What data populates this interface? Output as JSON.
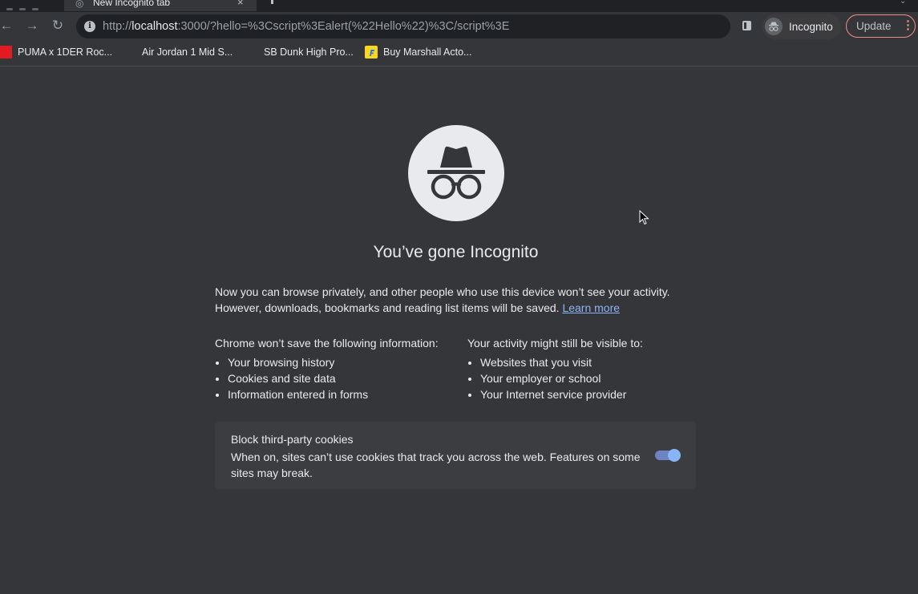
{
  "tabs": {
    "active_title": "New Incognito tab",
    "close_glyph": "×"
  },
  "toolbar": {
    "back_glyph": "←",
    "forward_glyph": "→",
    "reload_glyph": "↻",
    "url_scheme": "http://",
    "url_host": "localhost",
    "url_rest": ":3000/?hello=%3Cscript%3Ealert(%22Hello%22)%3C/script%3E",
    "incognito_label": "Incognito",
    "update_label": "Update",
    "menu_glyph": "⋮"
  },
  "bookmarks": [
    {
      "label": "PUMA x 1DER Roc...",
      "icon": "puma-favicon",
      "color": "#e21b23"
    },
    {
      "label": "Air Jordan 1 Mid S...",
      "icon": "blank-favicon",
      "color": ""
    },
    {
      "label": "SB Dunk High Pro...",
      "icon": "blank-favicon",
      "color": ""
    },
    {
      "label": "Buy Marshall Acto...",
      "icon": "flipkart-favicon",
      "color": "#f9d71c"
    }
  ],
  "page": {
    "heading": "You’ve gone Incognito",
    "intro_line1": "Now you can browse privately, and other people who use this device won’t see your activity.",
    "intro_line2": "However, downloads, bookmarks and reading list items will be saved.",
    "learn_more": "Learn more",
    "left_col_title_a": "Chrome ",
    "left_col_title_b": "won’t save",
    "left_col_title_c": " the following information:",
    "left_items": [
      "Your browsing history",
      "Cookies and site data",
      "Information entered in forms"
    ],
    "right_col_title_a": "Your activity ",
    "right_col_title_b": "might still be visible",
    "right_col_title_c": " to:",
    "right_items": [
      "Websites that you visit",
      "Your employer or school",
      "Your Internet service provider"
    ],
    "cookie_title": "Block third-party cookies",
    "cookie_desc": "When on, sites can’t use cookies that track you across the web. Features on some sites may break.",
    "cookie_toggle_on": true
  },
  "colors": {
    "background": "#35363a",
    "link": "#8ab4f8",
    "update_border": "#f28b82"
  }
}
